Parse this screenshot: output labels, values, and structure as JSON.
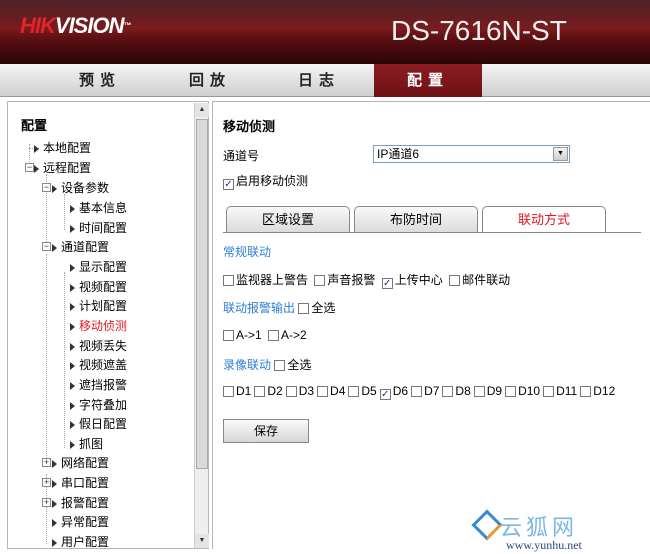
{
  "header": {
    "logo_red": "HIK",
    "logo_white": "VISION",
    "logo_tm": "™",
    "model": "DS-7616N-ST"
  },
  "menu": [
    {
      "label": "预览",
      "active": false
    },
    {
      "label": "回放",
      "active": false
    },
    {
      "label": "日志",
      "active": false
    },
    {
      "label": "配置",
      "active": true
    }
  ],
  "sidebar": {
    "title": "配置",
    "items": [
      {
        "label": "本地配置"
      },
      {
        "label": "远程配置"
      },
      {
        "label": "设备参数"
      },
      {
        "label": "基本信息"
      },
      {
        "label": "时间配置"
      },
      {
        "label": "通道配置"
      },
      {
        "label": "显示配置"
      },
      {
        "label": "视频配置"
      },
      {
        "label": "计划配置"
      },
      {
        "label": "移动侦测"
      },
      {
        "label": "视频丢失"
      },
      {
        "label": "视频遮盖"
      },
      {
        "label": "遮挡报警"
      },
      {
        "label": "字符叠加"
      },
      {
        "label": "假日配置"
      },
      {
        "label": "抓图"
      },
      {
        "label": "网络配置"
      },
      {
        "label": "串口配置"
      },
      {
        "label": "报警配置"
      },
      {
        "label": "异常配置"
      },
      {
        "label": "用户配置"
      }
    ],
    "expander_minus": "−",
    "expander_plus": "+"
  },
  "main": {
    "title": "移动侦测",
    "channel_label": "通道号",
    "channel_value": "IP通道6",
    "enable_label": "启用移动侦测",
    "enable_checked": true,
    "tabs": [
      {
        "label": "区域设置",
        "active": false
      },
      {
        "label": "布防时间",
        "active": false
      },
      {
        "label": "联动方式",
        "active": true
      }
    ],
    "normal_linkage_title": "常规联动",
    "normal_linkage": [
      {
        "label": "监视器上警告",
        "checked": false
      },
      {
        "label": "声音报警",
        "checked": false
      },
      {
        "label": "上传中心",
        "checked": true
      },
      {
        "label": "邮件联动",
        "checked": false
      }
    ],
    "alarm_output_title": "联动报警输出",
    "alarm_output_all": "全选",
    "alarm_outputs": [
      {
        "label": "A->1",
        "checked": false
      },
      {
        "label": "A->2",
        "checked": false
      }
    ],
    "record_title": "录像联动",
    "record_all": "全选",
    "record_channels": [
      {
        "label": "D1",
        "checked": false
      },
      {
        "label": "D2",
        "checked": false
      },
      {
        "label": "D3",
        "checked": false
      },
      {
        "label": "D4",
        "checked": false
      },
      {
        "label": "D5",
        "checked": false
      },
      {
        "label": "D6",
        "checked": true
      },
      {
        "label": "D7",
        "checked": false
      },
      {
        "label": "D8",
        "checked": false
      },
      {
        "label": "D9",
        "checked": false
      },
      {
        "label": "D10",
        "checked": false
      },
      {
        "label": "D11",
        "checked": false
      },
      {
        "label": "D12",
        "checked": false
      }
    ],
    "save_label": "保存"
  },
  "watermark": {
    "text": "云狐网",
    "url": "www.yunhu.net"
  },
  "colors": {
    "brand_red": "#7a1a1e",
    "selected_text": "#e3161e",
    "section_blue": "#2d7fd0"
  },
  "checkmark": "✓",
  "dropdown_arrow": "▼",
  "scroll_up": "▲",
  "scroll_down": "▼"
}
